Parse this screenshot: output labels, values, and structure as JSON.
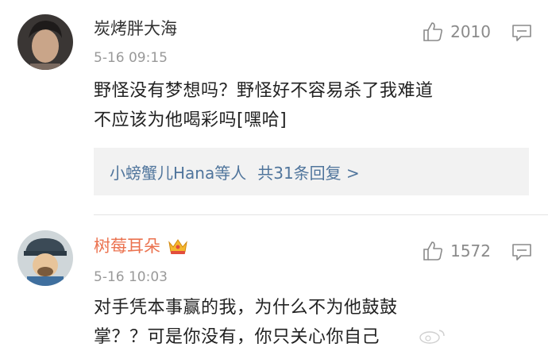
{
  "comments": [
    {
      "username": "炭烤胖大海",
      "timestamp": "5-16 09:15",
      "likes": "2010",
      "content_lines": [
        "野怪没有梦想吗？野怪好不容易杀了我难道",
        "不应该为他喝彩吗[嘿哈]"
      ],
      "replies": {
        "names": "小螃蟹儿Hana等人",
        "count_text": "共31条回复 >"
      }
    },
    {
      "username": "树莓耳朵",
      "badge_icon": "crown-icon",
      "timestamp": "5-16 10:03",
      "likes": "1572",
      "content_lines": [
        "对手凭本事赢的我，为什么不为他鼓鼓",
        "掌？？可是你没有，你只关心你自己"
      ]
    }
  ],
  "icons": {
    "like": "thumbs-up-icon",
    "reply": "comment-bubble-icon"
  },
  "colors": {
    "vip_name": "#eb7350",
    "link": "#50759c",
    "meta": "#999999"
  }
}
